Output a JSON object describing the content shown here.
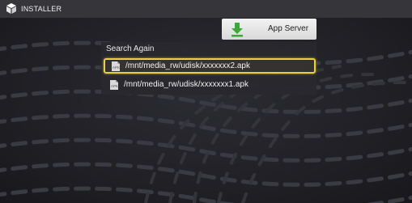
{
  "app": {
    "title": "INSTALLER",
    "icon": "installer-icon"
  },
  "toolbar": {
    "app_server_label": "App Server",
    "app_server_icon": "download-arrow-icon",
    "app_server_icon_color": "#3aa935"
  },
  "list": {
    "header": "Search Again",
    "items": [
      {
        "label": "/mnt/media_rw/udisk/xxxxxxx2.apk",
        "icon": "apk-file-icon",
        "selected": true
      },
      {
        "label": "/mnt/media_rw/udisk/xxxxxxx1.apk",
        "icon": "apk-file-icon",
        "selected": false
      }
    ]
  },
  "colors": {
    "selection_border": "#e8cf44",
    "background": "#232227"
  }
}
